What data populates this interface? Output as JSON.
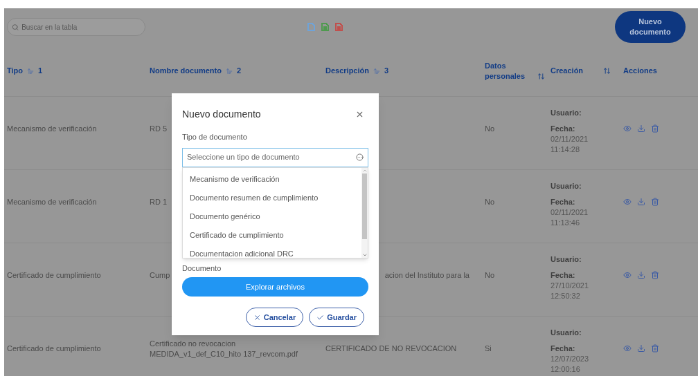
{
  "search": {
    "placeholder": "Buscar en la tabla"
  },
  "export_icons": [
    {
      "kind": "doc",
      "color": "#6fa3d8"
    },
    {
      "kind": "excel",
      "color": "#4f9a4f"
    },
    {
      "kind": "pdf",
      "color": "#c0504d"
    }
  ],
  "new_button": "Nuevo documento",
  "columns": [
    {
      "label": "Tipo",
      "kind": "ordered",
      "order": "1"
    },
    {
      "label": "Nombre documento",
      "kind": "ordered",
      "order": "2"
    },
    {
      "label": "Descripción",
      "kind": "ordered",
      "order": "3"
    },
    {
      "label": "Datos personales",
      "kind": "sortable"
    },
    {
      "label": "Creación",
      "kind": "sortable"
    },
    {
      "label": "Acciones",
      "kind": "plain"
    }
  ],
  "rows": [
    {
      "tipo": "Mecanismo de verificación",
      "nombre": "RD 5",
      "datos": "No",
      "usuario": "Usuario:",
      "fecha_label": "Fecha:",
      "fecha": "02/11/2021",
      "hora": "11:14:28"
    },
    {
      "tipo": "Mecanismo de verificación",
      "nombre": "RD 1",
      "datos": "No",
      "usuario": "Usuario:",
      "fecha_label": "Fecha:",
      "fecha": "02/11/2021",
      "hora": "11:13:46"
    },
    {
      "tipo": "Certificado de cumplimiento",
      "nombre": "Cump",
      "descripcion": "acion del Instituto para la",
      "description_cut": true,
      "datos": "No",
      "usuario": "Usuario:",
      "fecha_label": "Fecha:",
      "fecha": "27/10/2021",
      "hora": "12:50:32"
    },
    {
      "tipo": "Certificado de cumplimiento",
      "nombre": "Certificado no revocacion MEDIDA_v1_def_C10_hito 137_revcom.pdf",
      "descripcion": "CERTIFICADO DE NO REVOCACION",
      "description_cut": false,
      "datos": "Si",
      "usuario": "Usuario:",
      "fecha_label": "Fecha:",
      "fecha": "12/07/2023",
      "hora": "12:00:16"
    }
  ],
  "modal": {
    "title": "Nuevo documento",
    "type_label": "Tipo de documento",
    "select_placeholder": "Seleccione un tipo de documento",
    "expanded": true,
    "options": [
      "Mecanismo de verificación",
      "Documento resumen de cumplimiento",
      "Documento genérico",
      "Certificado de cumplimiento",
      "Documentacion adicional DRC"
    ],
    "document_label": "Documento",
    "browse_button": "Explorar archivos",
    "cancel_button": "Cancelar",
    "save_button": "Guardar"
  }
}
